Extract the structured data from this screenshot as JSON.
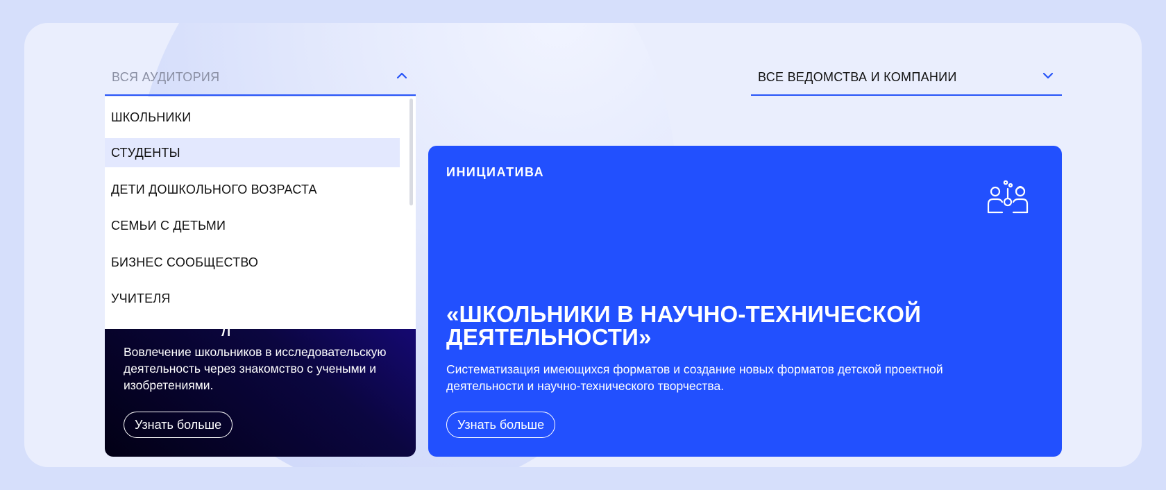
{
  "filters": {
    "audience": {
      "label": "ВСЯ АУДИТОРИЯ",
      "open": true
    },
    "departments": {
      "label": "ВСЕ ВЕДОМСТВА И КОМПАНИИ",
      "open": false
    }
  },
  "dropdown": {
    "items": [
      {
        "label": "ШКОЛЬНИКИ"
      },
      {
        "label": "СТУДЕНТЫ",
        "selected": true
      },
      {
        "label": "ДЕТИ ДОШКОЛЬНОГО ВОЗРАСТА"
      },
      {
        "label": "СЕМЬИ С ДЕТЬМИ"
      },
      {
        "label": "БИЗНЕС СООБЩЕСТВО"
      },
      {
        "label": "УЧИТЕЛЯ"
      }
    ]
  },
  "cards": {
    "dark": {
      "desc": "Вовлечение школьников в исследовательскую деятельность через знакомство с учеными и изобретениями.",
      "button": "Узнать больше"
    },
    "blue": {
      "tag": "ИНИЦИАТИВА",
      "title": "«ШКОЛЬНИКИ В НАУЧНО-ТЕХНИЧЕСКОЙ ДЕЯТЕЛЬНОСТИ»",
      "desc": "Систематизация имеющихся форматов и создание новых форматов детской проектной деятельности и научно-технического творчества.",
      "button": "Узнать больше",
      "icon": "scientists-icon"
    }
  },
  "colors": {
    "accent": "#2653f7",
    "card_blue": "#2250fe",
    "page_bg": "#d6dffb",
    "panel_bg": "#eaeefd",
    "selected_bg": "#e3e8fe"
  }
}
